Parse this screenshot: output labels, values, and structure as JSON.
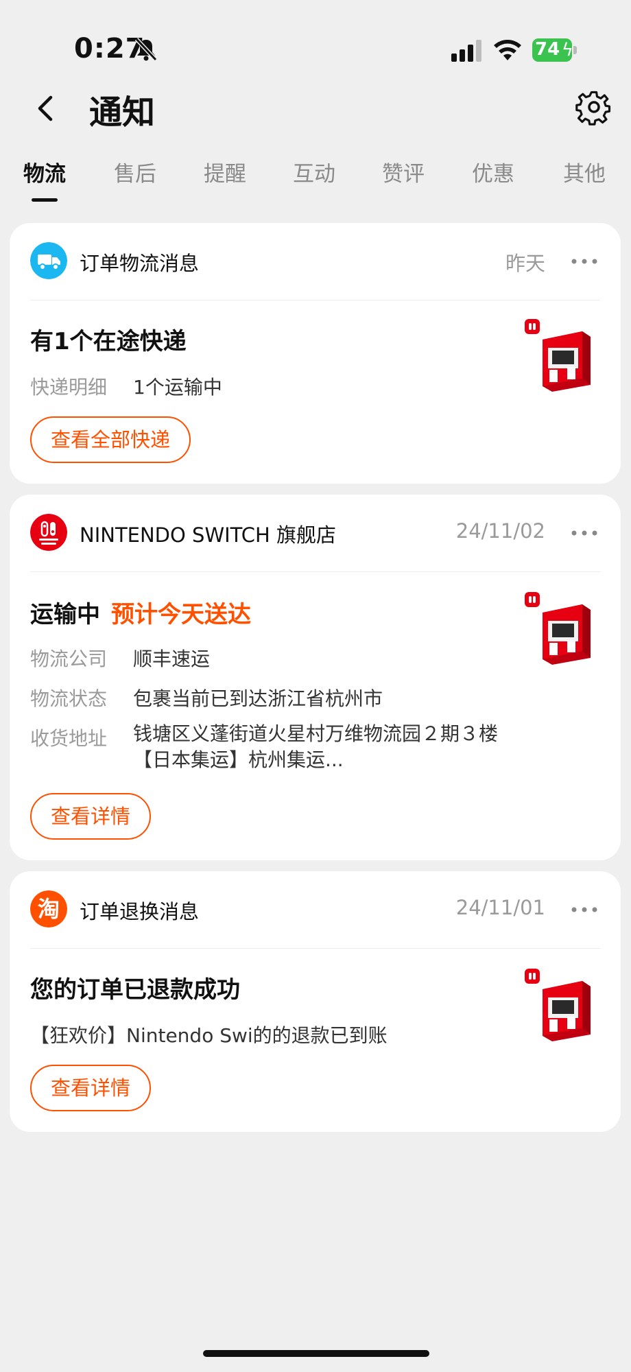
{
  "status_bar": {
    "time": "0:27",
    "battery": "74"
  },
  "header": {
    "title": "通知"
  },
  "tabs": [
    "物流",
    "售后",
    "提醒",
    "互动",
    "赞评",
    "优惠",
    "其他"
  ],
  "cards": [
    {
      "source": "订单物流消息",
      "date": "昨天",
      "headline": "有1个在途快递",
      "detail_label": "快递明细",
      "detail_value": "1个运输中",
      "button": "查看全部快递"
    },
    {
      "source": "NINTENDO SWITCH 旗舰店",
      "date": "24/11/02",
      "status": "运输中",
      "eta": "预计今天送达",
      "rows": [
        {
          "label": "物流公司",
          "value": "顺丰速运"
        },
        {
          "label": "物流状态",
          "value": "包裹当前已到达浙江省杭州市"
        },
        {
          "label": "收货地址",
          "value": "钱塘区义蓬街道火星村万维物流园２期３楼【日本集运】杭州集运..."
        }
      ],
      "button": "查看详情"
    },
    {
      "source": "订单退换消息",
      "date": "24/11/01",
      "headline": "您的订单已退款成功",
      "detail": "【狂欢价】Nintendo Swi的的退款已到账",
      "button": "查看详情"
    }
  ],
  "colors": {
    "accent": "#ff5000",
    "logistics_icon": "#1ab7f0",
    "nintendo_red": "#e60012",
    "taobao_orange": "#ff5000"
  },
  "icons": [
    "back-icon",
    "settings-icon",
    "truck-icon",
    "nintendo-switch-logo",
    "taobao-logo",
    "more-icon"
  ]
}
